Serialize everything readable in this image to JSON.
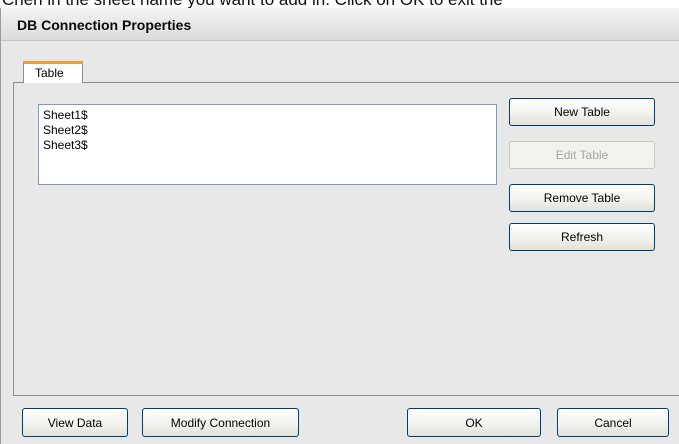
{
  "background_caption": "Chen in the sheet name you want to add in. Click on OK to exit the",
  "dialog": {
    "title": "DB Connection Properties",
    "tabs": [
      {
        "label": "Table",
        "selected": true
      }
    ],
    "table_list": {
      "items": [
        "Sheet1$",
        "Sheet2$",
        "Sheet3$"
      ]
    },
    "side_buttons": {
      "new_table": "New Table",
      "edit_table": "Edit Table",
      "remove_table": "Remove Table",
      "refresh": "Refresh"
    },
    "footer_buttons": {
      "view_data": "View Data",
      "modify_connection": "Modify Connection",
      "ok": "OK",
      "cancel": "Cancel"
    },
    "accent_color": "#f0a030",
    "disabled_text_color": "#a6a6a6"
  }
}
